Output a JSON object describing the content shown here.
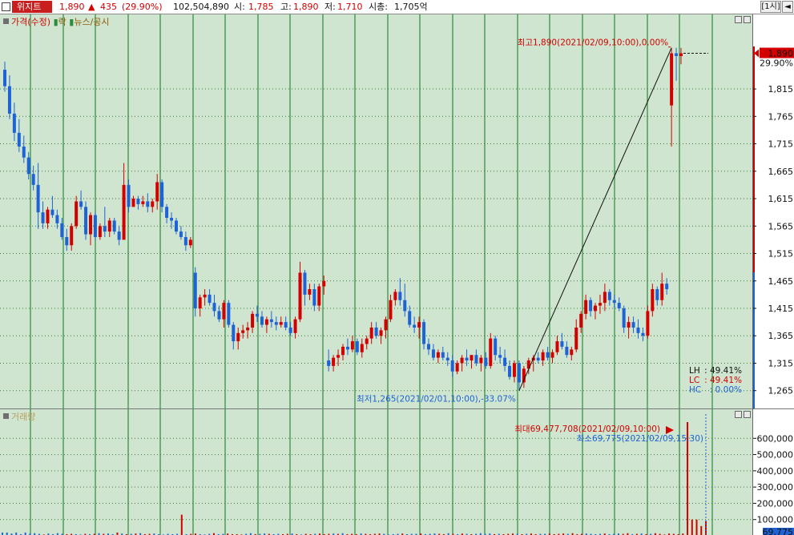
{
  "header": {
    "stock_name": "위지트",
    "price": "1,890",
    "arrow": "▲",
    "change": "435",
    "change_pct": "(29.90%)",
    "volume": "102,504,890",
    "open_label": "시:",
    "open": "1,785",
    "high_label": "고:",
    "high": "1,890",
    "low_label": "저:",
    "low": "1,710",
    "mcap_label": "시총:",
    "mcap": "1,705억",
    "interval_button": "[1시]",
    "nav_button": "◄"
  },
  "price_legend": {
    "items": [
      "가격(수정)",
      "락",
      "뉴스/공시"
    ]
  },
  "volume_legend": {
    "label": "거래량"
  },
  "annotations": {
    "high": "최고1,890(2021/02/09,10:00),0.00%",
    "low": "최저1,265(2021/02/01,10:00),-33.07%",
    "vol_max": "최대69,477,708(2021/02/09,10:00)",
    "vol_min": "최소69,775(2021/02/09,15:30)"
  },
  "ratios": {
    "lh_label": "LH",
    "lh": "49.41%",
    "lc_label": "LC",
    "lc": "49.41%",
    "hc_label": "HC",
    "hc": "0.00%"
  },
  "price_axis": {
    "current_price": "1,890",
    "current_pct": "29.90%",
    "ticks": [
      "1,815",
      "1,765",
      "1,715",
      "1,665",
      "1,615",
      "1,565",
      "1,515",
      "1,465",
      "1,415",
      "1,365",
      "1,315",
      "1,265"
    ]
  },
  "volume_axis": {
    "ticks": [
      "600,000",
      "500,000",
      "400,000",
      "300,000",
      "200,000",
      "100,000"
    ],
    "current_value": "69,775"
  },
  "colors": {
    "up": "#d40000",
    "down": "#1e63d6",
    "grid": "#2e8b3d",
    "background": "#cfe5cf"
  },
  "chart_data": {
    "type": "candlestick",
    "title": "",
    "ylim": [
      1250,
      1910
    ],
    "candles": [
      [
        1850,
        1865,
        1810,
        1820
      ],
      [
        1820,
        1840,
        1760,
        1770
      ],
      [
        1770,
        1790,
        1720,
        1735
      ],
      [
        1735,
        1760,
        1700,
        1710
      ],
      [
        1710,
        1730,
        1680,
        1690
      ],
      [
        1690,
        1700,
        1650,
        1660
      ],
      [
        1660,
        1675,
        1630,
        1640
      ],
      [
        1640,
        1680,
        1560,
        1590
      ],
      [
        1590,
        1610,
        1560,
        1570
      ],
      [
        1570,
        1600,
        1560,
        1595
      ],
      [
        1595,
        1620,
        1580,
        1585
      ],
      [
        1585,
        1595,
        1560,
        1570
      ],
      [
        1570,
        1580,
        1540,
        1545
      ],
      [
        1545,
        1560,
        1520,
        1530
      ],
      [
        1530,
        1570,
        1520,
        1565
      ],
      [
        1565,
        1620,
        1560,
        1610
      ],
      [
        1610,
        1630,
        1595,
        1600
      ],
      [
        1600,
        1610,
        1540,
        1550
      ],
      [
        1550,
        1590,
        1530,
        1585
      ],
      [
        1585,
        1590,
        1540,
        1545
      ],
      [
        1545,
        1570,
        1540,
        1565
      ],
      [
        1565,
        1600,
        1545,
        1555
      ],
      [
        1555,
        1580,
        1545,
        1575
      ],
      [
        1575,
        1580,
        1550,
        1555
      ],
      [
        1555,
        1565,
        1530,
        1540
      ],
      [
        1540,
        1680,
        1600,
        1640
      ],
      [
        1640,
        1650,
        1590,
        1600
      ],
      [
        1600,
        1620,
        1600,
        1615
      ],
      [
        1615,
        1620,
        1595,
        1605
      ],
      [
        1605,
        1620,
        1600,
        1610
      ],
      [
        1610,
        1625,
        1590,
        1600
      ],
      [
        1600,
        1615,
        1590,
        1610
      ],
      [
        1610,
        1660,
        1595,
        1645
      ],
      [
        1645,
        1650,
        1590,
        1600
      ],
      [
        1600,
        1605,
        1570,
        1580
      ],
      [
        1580,
        1590,
        1560,
        1575
      ],
      [
        1575,
        1580,
        1550,
        1555
      ],
      [
        1555,
        1565,
        1540,
        1545
      ],
      [
        1545,
        1555,
        1520,
        1530
      ],
      [
        1530,
        1545,
        1525,
        1540
      ],
      [
        1480,
        1490,
        1400,
        1415
      ],
      [
        1415,
        1440,
        1400,
        1435
      ],
      [
        1435,
        1450,
        1420,
        1440
      ],
      [
        1440,
        1450,
        1420,
        1425
      ],
      [
        1425,
        1440,
        1400,
        1410
      ],
      [
        1410,
        1420,
        1390,
        1395
      ],
      [
        1395,
        1430,
        1380,
        1425
      ],
      [
        1425,
        1430,
        1380,
        1385
      ],
      [
        1385,
        1390,
        1340,
        1355
      ],
      [
        1355,
        1380,
        1340,
        1370
      ],
      [
        1370,
        1385,
        1360,
        1375
      ],
      [
        1375,
        1390,
        1360,
        1380
      ],
      [
        1380,
        1410,
        1370,
        1405
      ],
      [
        1405,
        1420,
        1390,
        1400
      ],
      [
        1400,
        1410,
        1380,
        1385
      ],
      [
        1385,
        1400,
        1370,
        1395
      ],
      [
        1395,
        1410,
        1380,
        1390
      ],
      [
        1390,
        1400,
        1375,
        1385
      ],
      [
        1385,
        1400,
        1380,
        1390
      ],
      [
        1390,
        1400,
        1375,
        1380
      ],
      [
        1380,
        1390,
        1365,
        1370
      ],
      [
        1370,
        1400,
        1360,
        1395
      ],
      [
        1395,
        1500,
        1390,
        1480
      ],
      [
        1480,
        1485,
        1420,
        1440
      ],
      [
        1440,
        1460,
        1430,
        1450
      ],
      [
        1450,
        1460,
        1410,
        1420
      ],
      [
        1420,
        1460,
        1410,
        1455
      ],
      [
        1455,
        1475,
        1440,
        1465
      ],
      [
        1320,
        1340,
        1300,
        1310
      ],
      [
        1310,
        1330,
        1300,
        1325
      ],
      [
        1325,
        1340,
        1310,
        1330
      ],
      [
        1330,
        1350,
        1320,
        1345
      ],
      [
        1345,
        1360,
        1330,
        1340
      ],
      [
        1340,
        1365,
        1335,
        1355
      ],
      [
        1355,
        1360,
        1330,
        1335
      ],
      [
        1335,
        1360,
        1325,
        1350
      ],
      [
        1350,
        1365,
        1340,
        1360
      ],
      [
        1360,
        1390,
        1350,
        1380
      ],
      [
        1380,
        1390,
        1360,
        1365
      ],
      [
        1365,
        1380,
        1350,
        1375
      ],
      [
        1375,
        1400,
        1360,
        1395
      ],
      [
        1395,
        1440,
        1390,
        1430
      ],
      [
        1430,
        1450,
        1420,
        1445
      ],
      [
        1445,
        1470,
        1420,
        1430
      ],
      [
        1430,
        1460,
        1400,
        1410
      ],
      [
        1410,
        1420,
        1380,
        1385
      ],
      [
        1385,
        1400,
        1370,
        1380
      ],
      [
        1380,
        1400,
        1360,
        1390
      ],
      [
        1390,
        1395,
        1340,
        1350
      ],
      [
        1350,
        1360,
        1330,
        1340
      ],
      [
        1340,
        1350,
        1320,
        1325
      ],
      [
        1325,
        1340,
        1315,
        1335
      ],
      [
        1335,
        1345,
        1320,
        1325
      ],
      [
        1325,
        1335,
        1310,
        1320
      ],
      [
        1320,
        1330,
        1290,
        1300
      ],
      [
        1300,
        1320,
        1295,
        1315
      ],
      [
        1315,
        1330,
        1300,
        1325
      ],
      [
        1325,
        1340,
        1310,
        1320
      ],
      [
        1320,
        1330,
        1305,
        1330
      ],
      [
        1330,
        1340,
        1310,
        1315
      ],
      [
        1315,
        1330,
        1300,
        1325
      ],
      [
        1325,
        1335,
        1305,
        1310
      ],
      [
        1310,
        1370,
        1305,
        1360
      ],
      [
        1360,
        1365,
        1320,
        1330
      ],
      [
        1330,
        1345,
        1315,
        1325
      ],
      [
        1325,
        1340,
        1300,
        1310
      ],
      [
        1310,
        1320,
        1285,
        1290
      ],
      [
        1290,
        1320,
        1280,
        1315
      ],
      [
        1315,
        1320,
        1265,
        1280
      ],
      [
        1280,
        1310,
        1270,
        1305
      ],
      [
        1305,
        1325,
        1295,
        1320
      ],
      [
        1320,
        1330,
        1300,
        1325
      ],
      [
        1325,
        1335,
        1315,
        1320
      ],
      [
        1320,
        1340,
        1310,
        1335
      ],
      [
        1335,
        1345,
        1320,
        1325
      ],
      [
        1325,
        1340,
        1315,
        1335
      ],
      [
        1335,
        1365,
        1330,
        1355
      ],
      [
        1355,
        1370,
        1340,
        1345
      ],
      [
        1345,
        1355,
        1325,
        1330
      ],
      [
        1330,
        1345,
        1320,
        1340
      ],
      [
        1340,
        1395,
        1335,
        1380
      ],
      [
        1380,
        1410,
        1370,
        1405
      ],
      [
        1405,
        1440,
        1395,
        1430
      ],
      [
        1430,
        1435,
        1400,
        1410
      ],
      [
        1410,
        1425,
        1395,
        1420
      ],
      [
        1420,
        1440,
        1405,
        1425
      ],
      [
        1425,
        1460,
        1410,
        1445
      ],
      [
        1445,
        1450,
        1420,
        1430
      ],
      [
        1430,
        1440,
        1415,
        1425
      ],
      [
        1425,
        1435,
        1410,
        1415
      ],
      [
        1415,
        1420,
        1370,
        1380
      ],
      [
        1380,
        1400,
        1360,
        1390
      ],
      [
        1390,
        1400,
        1370,
        1380
      ],
      [
        1380,
        1395,
        1360,
        1370
      ],
      [
        1370,
        1380,
        1355,
        1365
      ],
      [
        1365,
        1420,
        1360,
        1410
      ],
      [
        1410,
        1460,
        1400,
        1450
      ],
      [
        1450,
        1455,
        1420,
        1430
      ],
      [
        1430,
        1480,
        1420,
        1460
      ],
      [
        1460,
        1470,
        1440,
        1450
      ],
      [
        1785,
        1890,
        1710,
        1880
      ],
      [
        1880,
        1890,
        1830,
        1875
      ],
      [
        1875,
        1890,
        1860,
        1880
      ]
    ],
    "volumes": [
      20,
      20,
      14,
      20,
      10,
      20,
      14,
      16,
      12,
      8,
      14,
      10,
      16,
      12,
      10,
      12,
      10,
      8,
      12,
      10,
      12,
      16,
      12,
      14,
      10,
      20,
      14,
      10,
      12,
      14,
      16,
      10,
      12,
      14,
      10,
      8,
      12,
      10,
      12,
      130,
      10,
      12,
      14,
      10,
      8,
      12,
      16,
      10,
      12,
      14,
      10,
      10,
      8,
      12,
      16,
      10,
      12,
      14,
      12,
      10,
      12,
      10,
      12,
      14,
      10,
      8,
      12,
      10,
      12,
      14,
      10,
      12,
      14,
      12,
      16,
      10,
      12,
      10,
      14,
      12,
      10,
      12,
      14,
      12,
      8,
      10,
      12,
      14,
      10,
      12,
      12,
      14,
      10,
      12,
      14,
      12,
      10,
      16,
      12,
      10,
      14,
      12,
      10,
      12,
      16,
      12,
      14,
      10,
      12,
      10,
      12,
      14,
      12,
      10,
      12,
      14,
      10,
      12,
      12,
      14,
      10,
      12,
      14,
      12,
      16,
      10,
      12,
      14,
      12,
      10,
      12,
      14,
      10,
      12,
      14,
      12,
      16,
      10,
      12,
      14,
      10,
      12,
      16,
      12,
      8,
      14,
      12,
      10,
      14,
      700,
      100,
      100,
      60,
      90
    ]
  }
}
